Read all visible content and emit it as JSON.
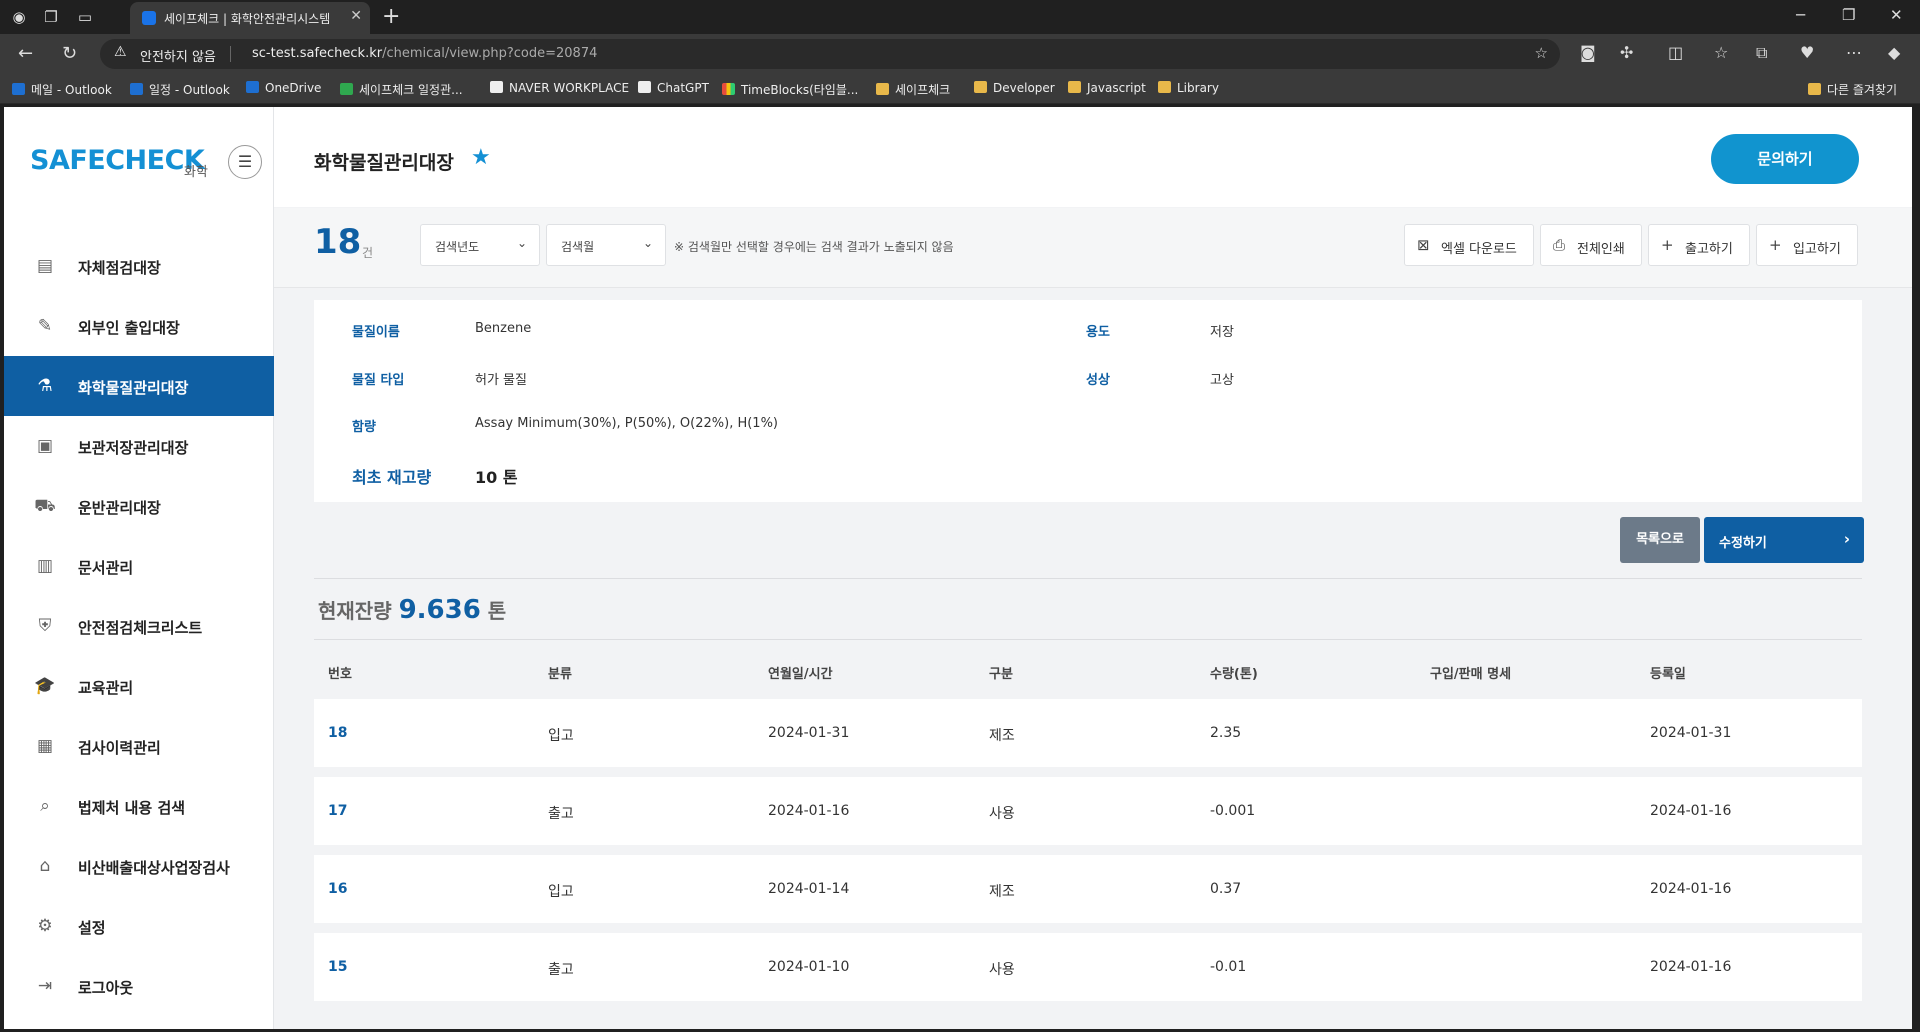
{
  "browser": {
    "tab_title": "세이프체크 | 화학안전관리시스템",
    "security_warning": "안전하지 않음",
    "url_host": "sc-test.safecheck.kr",
    "url_path": "/chemical/view.php?code=20874",
    "bookmarks": [
      "메일 - Outlook",
      "일정 - Outlook",
      "OneDrive",
      "세이프체크 일정관...",
      "NAVER WORKPLACE",
      "ChatGPT",
      "TimeBlocks(타임블...",
      "세이프체크",
      "Developer",
      "Javascript",
      "Library"
    ],
    "other_bookmarks": "다른 즐겨찾기"
  },
  "sidebar": {
    "logo": "SAFECHECK",
    "logo_sub": "화학",
    "items": [
      {
        "label": "자체점검대장",
        "icon": "clipboard-icon"
      },
      {
        "label": "외부인 출입대장",
        "icon": "calendar-edit-icon"
      },
      {
        "label": "화학물질관리대장",
        "icon": "flask-icon"
      },
      {
        "label": "보관저장관리대장",
        "icon": "archive-box-icon"
      },
      {
        "label": "운반관리대장",
        "icon": "dolly-icon"
      },
      {
        "label": "문서관리",
        "icon": "document-icon"
      },
      {
        "label": "안전점검체크리스트",
        "icon": "shield-check-icon"
      },
      {
        "label": "교육관리",
        "icon": "graduation-cap-icon"
      },
      {
        "label": "검사이력관리",
        "icon": "inspection-history-icon"
      },
      {
        "label": "법제처 내용 검색",
        "icon": "doc-search-icon"
      },
      {
        "label": "비산배출대상사업장검사",
        "icon": "factory-icon"
      },
      {
        "label": "설정",
        "icon": "gear-icon"
      },
      {
        "label": "로그아웃",
        "icon": "logout-icon"
      }
    ],
    "active_index": 2
  },
  "header": {
    "title": "화학물질관리대장",
    "inquiry_button": "문의하기"
  },
  "toolbar": {
    "count": "18",
    "count_unit": "건",
    "year_select": "검색년도",
    "month_select": "검색월",
    "note": "※ 검색월만 선택할 경우에는 검색 결과가 노출되지 않음",
    "excel_button": "엑셀 다운로드",
    "print_button": "전체인쇄",
    "outgoing_button": "출고하기",
    "incoming_button": "입고하기"
  },
  "detail": {
    "name_label": "물질이름",
    "name_value": "Benzene",
    "usage_label": "용도",
    "usage_value": "저장",
    "type_label": "물질 타입",
    "type_value": "허가 물질",
    "state_label": "성상",
    "state_value": "고상",
    "content_label": "함량",
    "content_value": "Assay Minimum(30%), P(50%), O(22%), H(1%)",
    "initial_stock_label": "최초 재고량",
    "initial_stock_value": "10 톤"
  },
  "actions": {
    "list_button": "목록으로",
    "edit_button": "수정하기"
  },
  "remaining": {
    "label": "현재잔량",
    "value": "9.636",
    "unit": "톤"
  },
  "table": {
    "columns": [
      "번호",
      "분류",
      "연월일/시간",
      "구분",
      "수량(톤)",
      "구입/판매 명세",
      "등록일"
    ],
    "rows": [
      {
        "no": "18",
        "category": "입고",
        "date": "2024-01-31",
        "division": "제조",
        "qty": "2.35",
        "spec": "",
        "reg": "2024-01-31"
      },
      {
        "no": "17",
        "category": "출고",
        "date": "2024-01-16",
        "division": "사용",
        "qty": "-0.001",
        "spec": "",
        "reg": "2024-01-16"
      },
      {
        "no": "16",
        "category": "입고",
        "date": "2024-01-14",
        "division": "제조",
        "qty": "0.37",
        "spec": "",
        "reg": "2024-01-16"
      },
      {
        "no": "15",
        "category": "출고",
        "date": "2024-01-10",
        "division": "사용",
        "qty": "-0.01",
        "spec": "",
        "reg": "2024-01-16"
      }
    ]
  },
  "colors": {
    "brand": "#1490d4",
    "primary_dark": "#0f5fa3",
    "inquiry_button": "#1194cf",
    "list_button": "#6c7a89"
  }
}
